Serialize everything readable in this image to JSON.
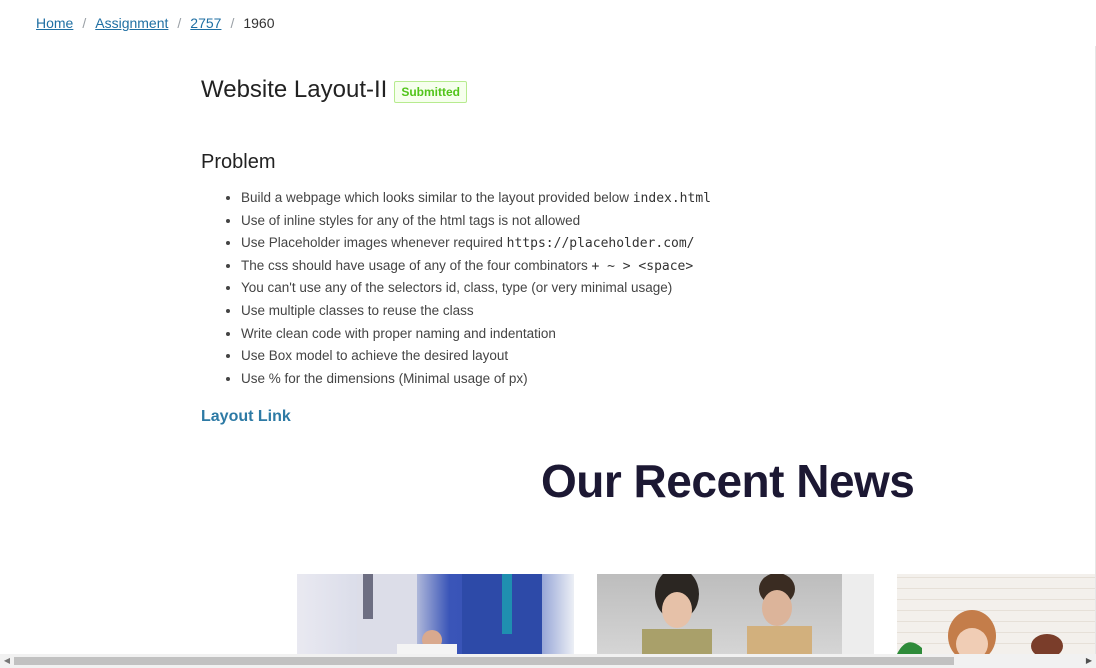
{
  "breadcrumb": {
    "items": [
      {
        "label": "Home"
      },
      {
        "label": "Assignment"
      },
      {
        "label": "2757"
      }
    ],
    "separator": "/",
    "current": "1960"
  },
  "assignment": {
    "title": "Website Layout-II",
    "status": "Submitted"
  },
  "problem": {
    "heading": "Problem",
    "items": [
      {
        "text": "Build a webpage which looks similar to the layout provided below ",
        "code": "index.html"
      },
      {
        "text": "Use of inline styles for any of the html tags is not allowed"
      },
      {
        "text": "Use Placeholder images whenever required ",
        "code": "https://placeholder.com/"
      },
      {
        "text": "The css should have usage of any of the four combinators ",
        "code": "+ ~ > <space>"
      },
      {
        "text": "You can't use any of the selectors id, class, type (or very minimal usage)"
      },
      {
        "text": "Use multiple classes to reuse the class"
      },
      {
        "text": "Write clean code with proper naming and indentation"
      },
      {
        "text": "Use Box model to achieve the desired layout"
      },
      {
        "text": "Use % for the dimensions (Minimal usage of px)"
      }
    ],
    "link_label": "Layout Link"
  },
  "preview": {
    "heading": "Our Recent News"
  },
  "scrollbar": {
    "left_arrow": "◀",
    "right_arrow": "▶"
  }
}
